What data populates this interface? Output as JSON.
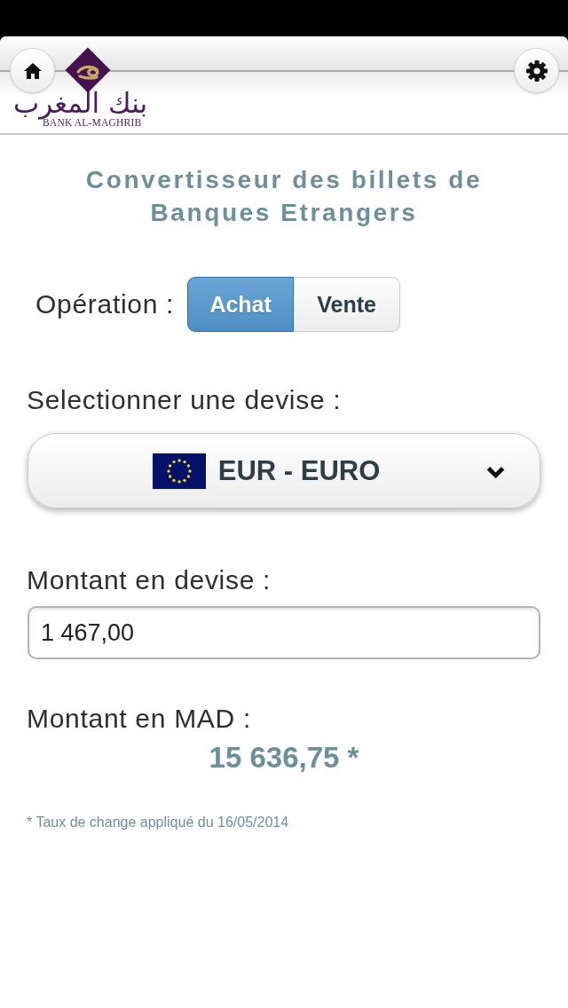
{
  "header": {
    "logo": {
      "arabic": "بنك المغرب",
      "latin": "BANK AL-MAGHRIB"
    }
  },
  "title": "Convertisseur des billets de Banques Etrangers",
  "operation": {
    "label": "Opération :",
    "options": [
      {
        "label": "Achat",
        "selected": true
      },
      {
        "label": "Vente",
        "selected": false
      }
    ]
  },
  "currency": {
    "label": "Selectionner une devise :",
    "value": "EUR - EURO"
  },
  "amount": {
    "label": "Montant en devise :",
    "value": "1 467,00"
  },
  "result": {
    "label": "Montant en MAD :",
    "value": "15 636,75 *"
  },
  "footnote": "* Taux de change appliqué du 16/05/2014"
}
